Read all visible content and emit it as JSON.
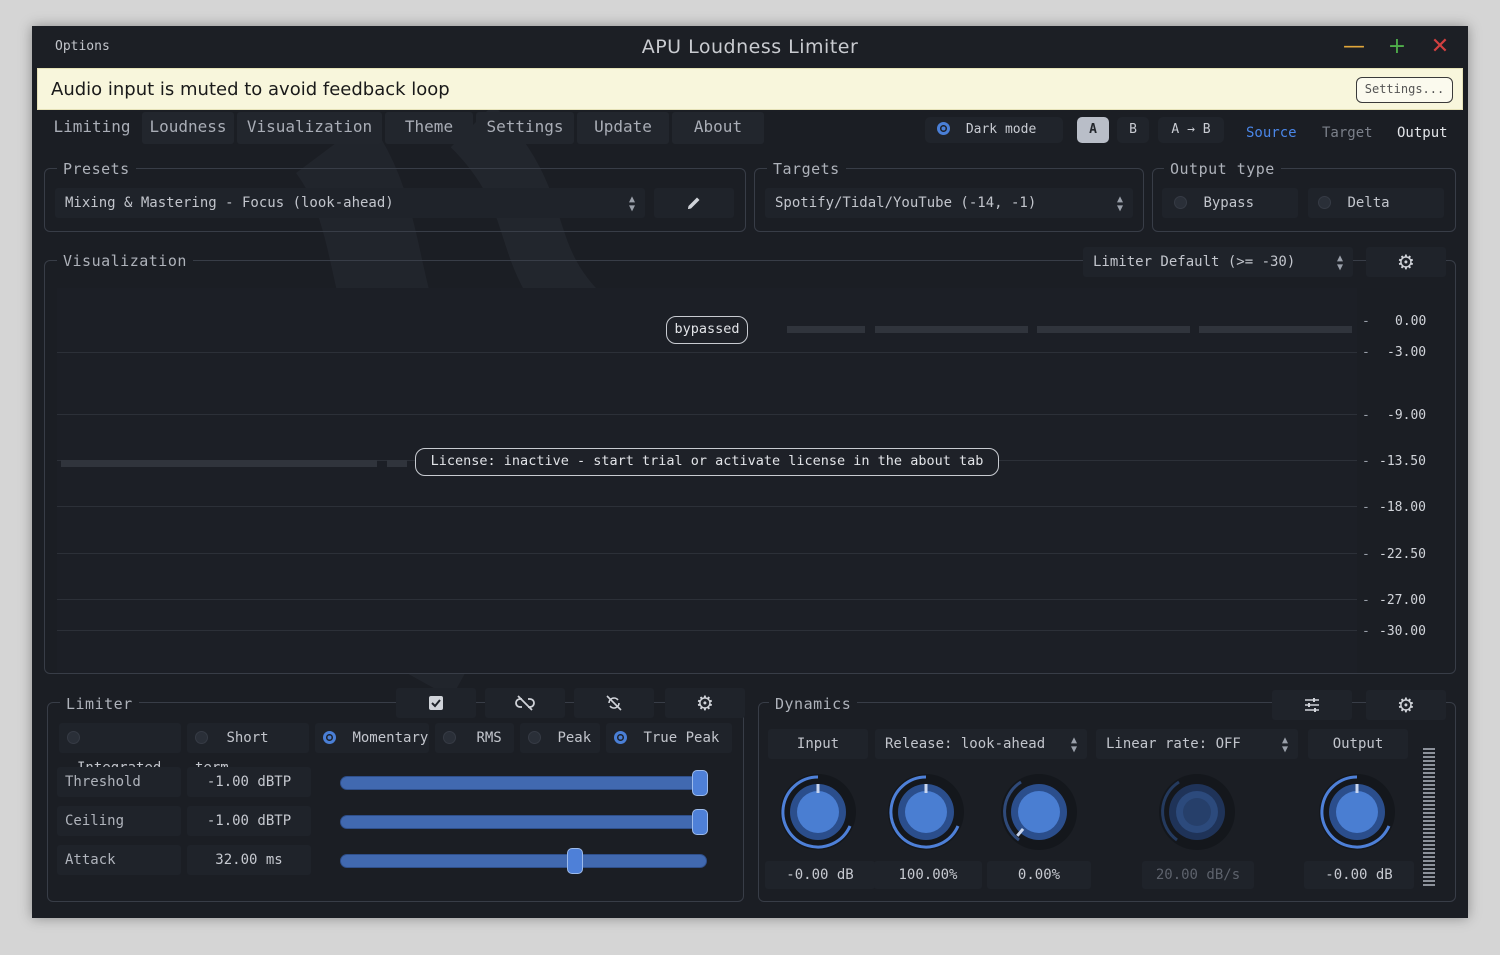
{
  "titlebar": {
    "options": "Options",
    "title": "APU Loudness Limiter"
  },
  "notice": {
    "message": "Audio input is muted to avoid feedback loop",
    "settings_button": "Settings..."
  },
  "tabs": [
    "Limiting",
    "Loudness",
    "Visualization",
    "Theme",
    "Settings",
    "Update",
    "About"
  ],
  "toolbar": {
    "dark_mode": "Dark mode",
    "a": "A",
    "b": "B",
    "a_to_b": "A → B",
    "source": "Source",
    "target": "Target",
    "output": "Output"
  },
  "presets": {
    "label": "Presets",
    "value": "Mixing & Mastering - Focus (look-ahead)"
  },
  "targets": {
    "label": "Targets",
    "value": "Spotify/Tidal/YouTube (-14, -1)"
  },
  "output_type": {
    "label": "Output type",
    "bypass": "Bypass",
    "delta": "Delta"
  },
  "visualization": {
    "label": "Visualization",
    "preset": "Limiter Default (>= -30)",
    "bypassed": "bypassed",
    "license": "License: inactive - start trial or activate license in the about tab",
    "ticks": [
      "0.00",
      "-3.00",
      "-9.00",
      "-13.50",
      "-18.00",
      "-22.50",
      "-27.00",
      "-30.00"
    ]
  },
  "limiter": {
    "label": "Limiter",
    "modes": [
      "Integrated",
      "Short term",
      "Momentary",
      "RMS",
      "Peak",
      "True Peak"
    ],
    "rows": [
      {
        "name": "Threshold",
        "value": "-1.00 dBTP",
        "level": 0.98
      },
      {
        "name": "Ceiling",
        "value": "-1.00 dBTP",
        "level": 0.98
      },
      {
        "name": "Attack",
        "value": "32.00 ms",
        "level": 0.64
      }
    ]
  },
  "dynamics": {
    "label": "Dynamics",
    "input": "Input",
    "release": "Release: look-ahead",
    "linear_rate": "Linear rate: OFF",
    "output": "Output",
    "values": [
      "-0.00 dB",
      "100.00%",
      "0.00%",
      "20.00 dB/s",
      "-0.00 dB"
    ]
  },
  "colors": {
    "accent": "#4a7fd6",
    "background": "#1b1e24",
    "notice": "#f8f6dc"
  }
}
